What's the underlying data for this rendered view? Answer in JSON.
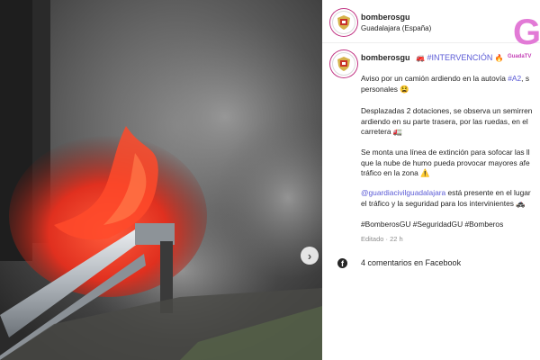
{
  "post": {
    "username": "bomberosgu",
    "location": "Guadalajara (España)"
  },
  "watermark": {
    "letter": "G",
    "text": "GuadaTV"
  },
  "caption": {
    "username": "bomberosgu",
    "head_emoji_1": "🚒",
    "head_tag": "#INTERVENCIÓN",
    "head_emoji_2": "🔥",
    "paragraphs": [
      [
        "Aviso por un camión ardiendo en la autovía #A2, s",
        "personales 😫"
      ],
      [
        "Desplazadas 2 dotaciones, se observa un semirren",
        "ardiendo en su parte trasera, por las ruedas, en el",
        "carretera 🚛"
      ],
      [
        "Se monta una línea de extinción para sofocar las ll",
        "que la nube de humo pueda provocar mayores afe",
        "tráfico en la zona ⚠️"
      ],
      [
        "@guardiacivilguadalajara está presente en el lugar",
        "el tráfico y la seguridad para los intervinientes 🚓"
      ],
      [
        "#BomberosGU #SeguridadGU #Bomberos"
      ]
    ],
    "mention": "@guardiacivilguadalajara",
    "hashtag_a2": "#A2",
    "meta": "Editado · 22 h"
  },
  "comments": {
    "icon": "facebook-icon",
    "label": "4 comentarios en Facebook"
  },
  "icons": {
    "next": "chevron-right-icon",
    "avatar": "firefighter-shield-icon"
  },
  "colors": {
    "link": "#5a5ad6",
    "watermark": "#e27ad6",
    "story_ring": "#c13584"
  }
}
